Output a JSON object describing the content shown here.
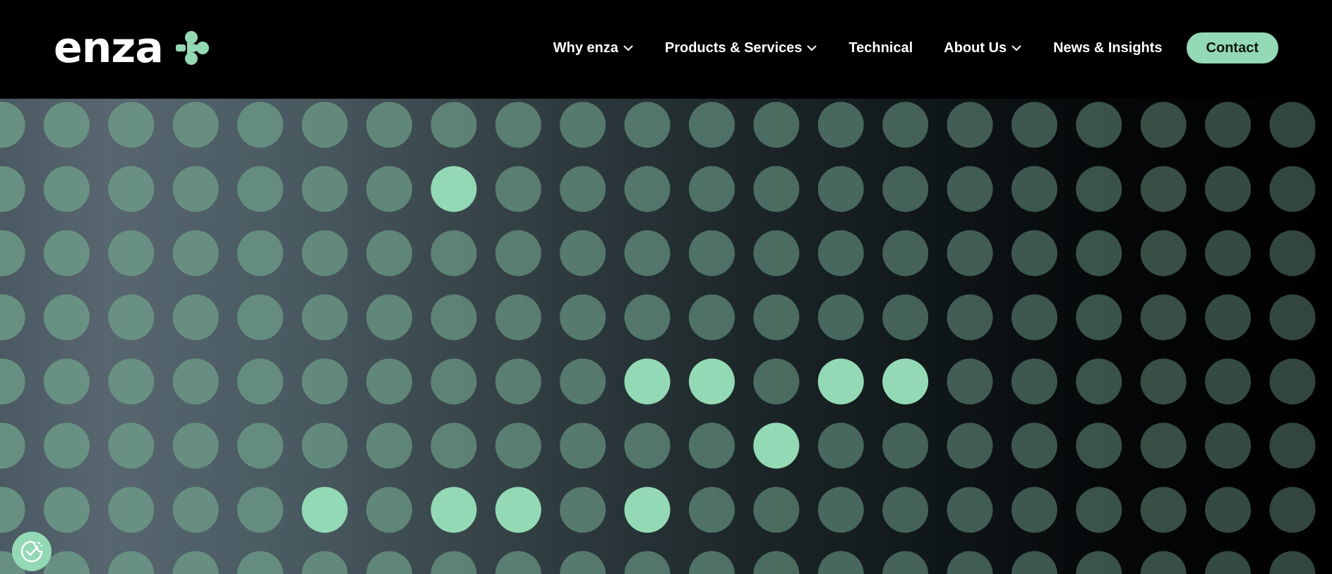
{
  "brand": {
    "logo_text": "enza",
    "logo_icon": "molecule-arrow-icon",
    "accent": "#94d9b5"
  },
  "nav": {
    "items": [
      {
        "label": "Why enza",
        "dropdown": true
      },
      {
        "label": "Products & Services",
        "dropdown": true
      },
      {
        "label": "Technical",
        "dropdown": false
      },
      {
        "label": "About Us",
        "dropdown": true
      },
      {
        "label": "News & Insights",
        "dropdown": false
      }
    ],
    "contact_label": "Contact"
  },
  "hero": {
    "dot_color": "#6e9c89",
    "highlight_color": "#94d9b5",
    "highlighted_dots": [
      [
        1,
        7
      ],
      [
        4,
        10
      ],
      [
        4,
        11
      ],
      [
        4,
        13
      ],
      [
        4,
        14
      ],
      [
        5,
        12
      ],
      [
        6,
        5
      ],
      [
        6,
        7
      ],
      [
        6,
        8
      ],
      [
        6,
        10
      ]
    ]
  },
  "cookie_widget": {
    "icon": "cookie-check-icon"
  }
}
